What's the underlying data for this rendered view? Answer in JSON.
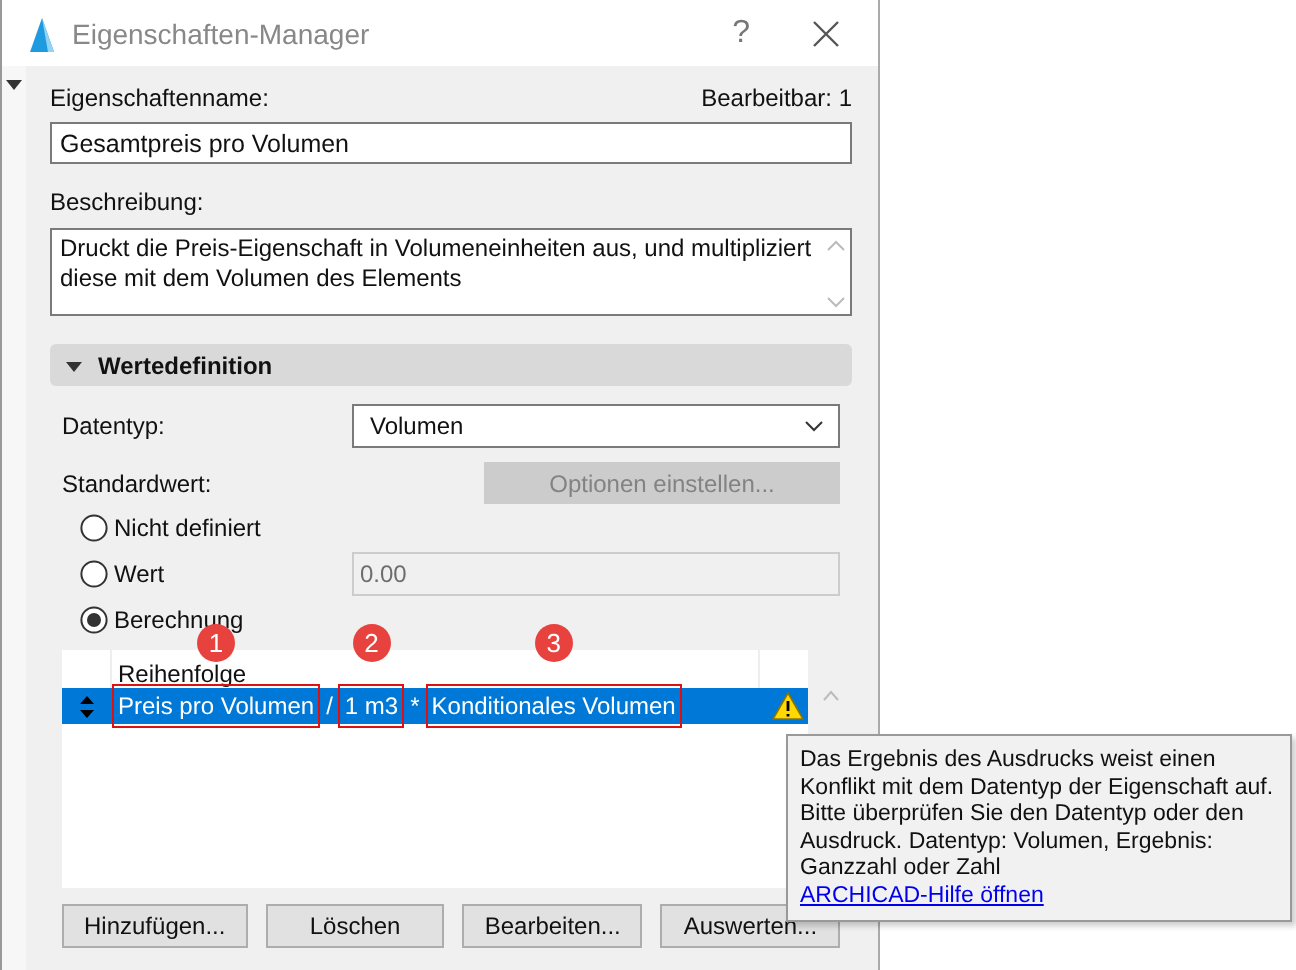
{
  "window": {
    "title": "Eigenschaften-Manager",
    "help_button": "?"
  },
  "property_name": {
    "label": "Eigenschaftenname:",
    "value": "Gesamtpreis pro Volumen"
  },
  "editable": "Bearbeitbar: 1",
  "description": {
    "label": "Beschreibung:",
    "value": "Druckt die Preis-Eigenschaft in Volumeneinheiten aus, und multipliziert diese mit dem Volumen des Elements"
  },
  "value_definition": {
    "title": "Wertedefinition",
    "expanded": true,
    "data_type": {
      "label": "Datentyp:",
      "value": "Volumen"
    },
    "default_value": {
      "label": "Standardwert:",
      "options_button": {
        "label": "Optionen einstellen...",
        "disabled": true
      }
    },
    "options": [
      {
        "label": "Nicht definiert",
        "selected": false
      },
      {
        "label": "Wert",
        "selected": false,
        "field_value": "0.00",
        "field_disabled": true
      },
      {
        "label": "Berechnung",
        "selected": true
      }
    ],
    "expressions": {
      "column": "Reihenfolge",
      "rows": [
        {
          "selected": true,
          "warning": true,
          "parts": [
            {
              "kind": "term",
              "text": "Preis pro Volumen",
              "callout": "1"
            },
            {
              "kind": "operator",
              "text": "/"
            },
            {
              "kind": "term",
              "text": "1 m3",
              "callout": "2"
            },
            {
              "kind": "operator",
              "text": "*"
            },
            {
              "kind": "term",
              "text": "Konditionales Volumen",
              "callout": "3"
            }
          ]
        }
      ]
    }
  },
  "buttons": [
    {
      "label": "Hinzufügen..."
    },
    {
      "label": "Löschen"
    },
    {
      "label": "Bearbeiten..."
    },
    {
      "label": "Auswerten..."
    }
  ],
  "tooltip": {
    "text": "Das Ergebnis des Ausdrucks weist einen Konflikt mit dem Datentyp der Eigenschaft auf. Bitte überprüfen Sie den Datentyp oder den Ausdruck. Datentyp: Volumen, Ergebnis: Ganzzahl oder Zahl",
    "link": "ARCHICAD-Hilfe öffnen"
  }
}
